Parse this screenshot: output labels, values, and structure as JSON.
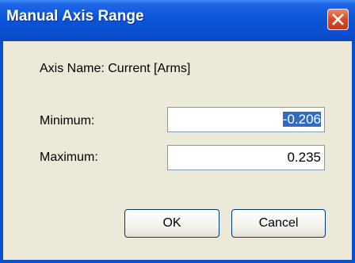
{
  "window": {
    "title": "Manual Axis Range"
  },
  "content": {
    "axis_name": "Axis Name: Current [Arms]",
    "minimum_label": "Minimum:",
    "maximum_label": "Maximum:",
    "minimum_value": "-0.206",
    "maximum_value": "0.235"
  },
  "buttons": {
    "ok": "OK",
    "cancel": "Cancel"
  },
  "icons": {
    "close": "close-icon"
  },
  "colors": {
    "titlebar": "#0a4fd0",
    "dialog_bg": "#ece9d8",
    "selection": "#316ac5",
    "close_button": "#d6502a"
  }
}
